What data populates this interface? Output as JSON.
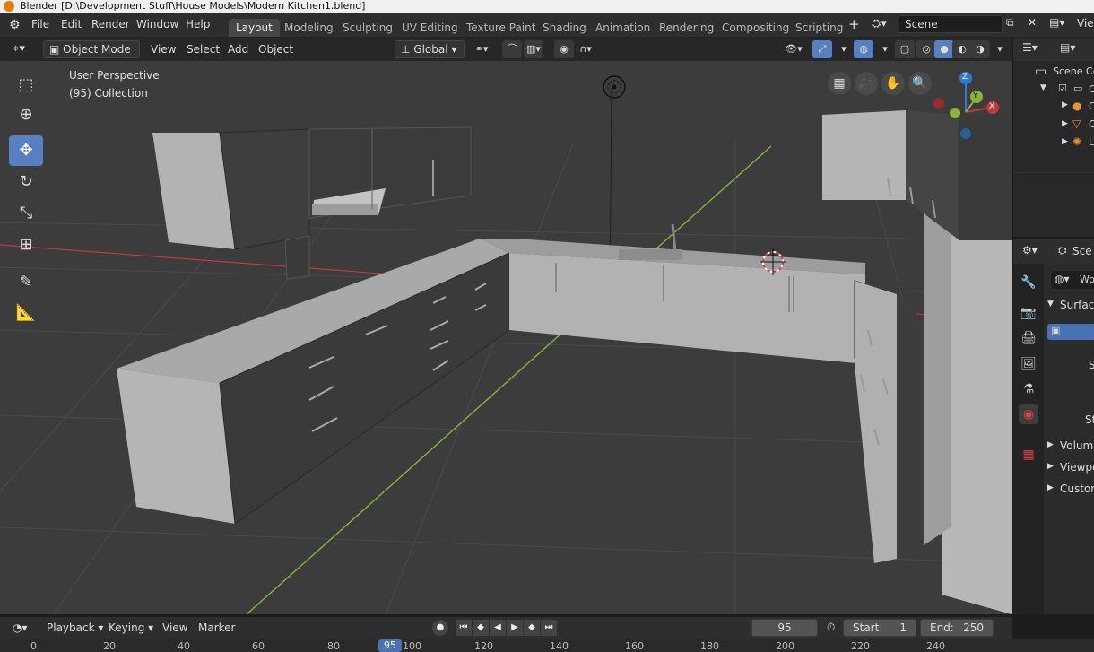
{
  "titlebar": {
    "title": "Blender [D:\\Development Stuff\\House Models\\Modern Kitchen1.blend]"
  },
  "menu": [
    "File",
    "Edit",
    "Render",
    "Window",
    "Help"
  ],
  "workspaces": [
    "Layout",
    "Modeling",
    "Sculpting",
    "UV Editing",
    "Texture Paint",
    "Shading",
    "Animation",
    "Rendering",
    "Compositing",
    "Scripting"
  ],
  "scene": {
    "name": "Scene",
    "view_layer_label": "Vie"
  },
  "viewport_header": {
    "mode": "Object Mode",
    "menus": [
      "View",
      "Select",
      "Add",
      "Object"
    ],
    "orientation": "Global"
  },
  "viewport": {
    "perspective": "User Perspective",
    "collection": "(95) Collection",
    "axis_labels": {
      "x": "X",
      "y": "Y",
      "z": "Z"
    },
    "colors": {
      "x_axis": "#c0393b",
      "y_axis": "#8ab33a",
      "z_axis": "#2f7ad4",
      "grid": "#4a4a4a",
      "background": "#3c3c3c"
    }
  },
  "outliner": {
    "root": "Scene Co",
    "items": [
      {
        "label": "C",
        "icon": "collection-icon"
      },
      {
        "label": "C",
        "icon": "camera-icon"
      },
      {
        "label": "C",
        "icon": "cone-icon"
      },
      {
        "label": "L",
        "icon": "light-icon"
      }
    ]
  },
  "properties": {
    "header": "Sce",
    "world_field": "Wo",
    "panels": {
      "surface": "Surface",
      "volume": "Volume",
      "viewport": "Viewpo",
      "custom": "Custom"
    },
    "labels": {
      "s1": "S",
      "s2": "Str"
    }
  },
  "timeline": {
    "menus": [
      "Playback",
      "Keying",
      "View",
      "Marker"
    ],
    "current_frame": "95",
    "start_label": "Start:",
    "start": "1",
    "end_label": "End:",
    "end": "250"
  },
  "ruler": {
    "ticks": [
      "0",
      "20",
      "40",
      "60",
      "80",
      "100",
      "120",
      "140",
      "160",
      "180",
      "200",
      "220",
      "240"
    ],
    "current": "95"
  }
}
